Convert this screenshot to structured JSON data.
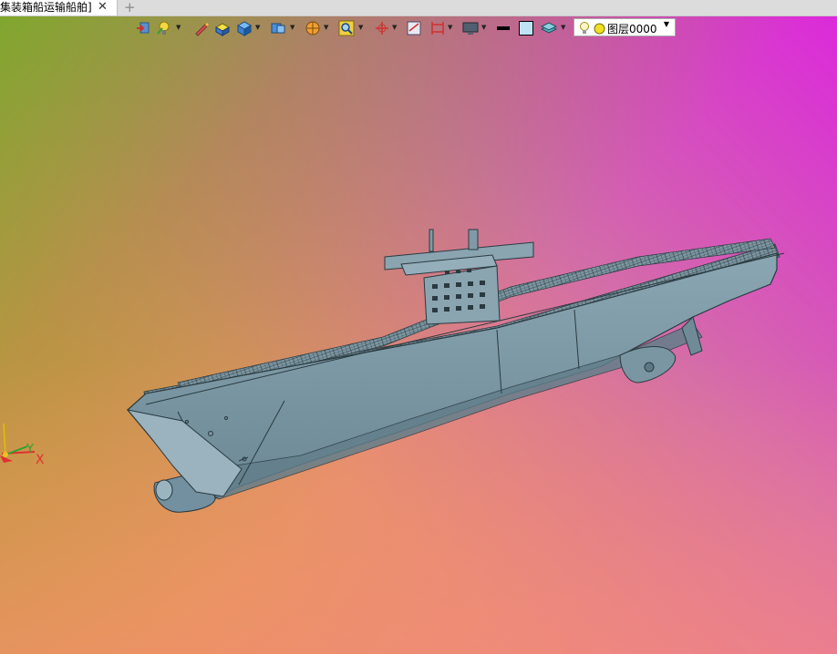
{
  "tab": {
    "title": "集装箱船运输船舶]",
    "close_glyph": "✕",
    "add_glyph": "+"
  },
  "toolbar": {
    "icons": [
      "import-icon",
      "light-icon",
      "pencil-icon",
      "box-yellow-icon",
      "box-blue-icon",
      "view-cube-icon",
      "sphere-icon",
      "zoom-icon",
      "axis-icon",
      "section-icon",
      "frame-icon",
      "monitor-icon",
      "line-weight-icon",
      "color-swatch-icon",
      "layer-stack-icon"
    ],
    "color_swatch": "#bfe3f5",
    "layer_select": {
      "value": "图层0000"
    }
  },
  "colors": {
    "hull": "#7f9aa6",
    "hull_dark": "#5f7a86",
    "outline": "#2a3a40",
    "axis_x": "#e03030",
    "axis_y": "#30a030",
    "axis_z": "#ffcc00"
  },
  "axes": {
    "x_label": "X",
    "y_label": "Y"
  }
}
